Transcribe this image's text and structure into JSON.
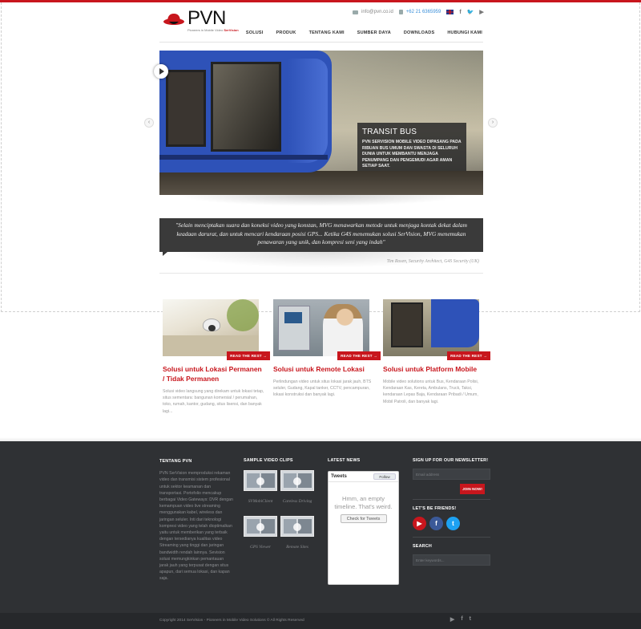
{
  "header": {
    "logo_text": "PVN",
    "logo_tagline": "Pioneers in Mobile Video",
    "logo_tagline_brand": "SerVision",
    "email": "info@pvn.co.id",
    "phone": "+62 21 6365959",
    "nav": [
      "SOLUSI",
      "PRODUK",
      "TENTANG KAMI",
      "SUMBER DAYA",
      "DOWNLOADS",
      "HUBUNGI KAMI"
    ]
  },
  "slider": {
    "title": "TRANSIT BUS",
    "description": "PVN SERVISION MOBILE VIDEO DIPASANG PADA RIBUAN BUS UMUM DAN SWASTA DI SELURUH DUNIA UNTUK MEMBANTU MENJAGA PENUMPANG DAN PENGEMUDI AGAR AMAN SETIAP SAAT.",
    "prev": "‹",
    "next": "›"
  },
  "testimonial": {
    "quote": "\"Selain menciptakan suara dan koneksi video yang konstan, MVG menawarkan metode untuk menjaga kontak dekat dalam keadaan darurat, dan untuk mencari kendaraan posisi GPS... Ketika G4S menemukan solusi SerVision, MVG menemukan penawaran yang unik, dan kompresi seni yang indah\"",
    "author": "Tim Rosen, Security Architect, G4S Security (UK)"
  },
  "solutions": [
    {
      "button": "READ THE REST →",
      "title": "Solusi untuk Lokasi Permanen / Tidak Permanen",
      "desc": "Solusi video langsung yang direkam untuk lokasi tetap, situs sementara: bangunan komersial / perumahan, toko, rumah, kantor, gudang, situs lisensi, dan banyak lagi..."
    },
    {
      "button": "READ THE REST →",
      "title": "Solusi untuk Remote Lokasi",
      "desc": "Perlindungan video untuk situs lokasi jarak jauh, BTS seluler, Gudang, Kapal tanker, CCTV, pencampuran, lokasi konstruksi dan banyak lagi."
    },
    {
      "button": "READ THE REST →",
      "title": "Solusi untuk Platform Mobile",
      "desc": "Mobile video solutions untuk Bus, Kendaraan Polisi, Kendaraan Kas, Kereta, Ambulans, Truck, Taksi, kendaraan Lepas Baja, Kendaraan Pribadi / Umum, Mobil Patroli, dan banyak lagi."
    }
  ],
  "footer": {
    "about_title": "TENTANG PVN",
    "about_text": "PVN SerVision memproduksi rekaman video dan transmisi sistem profesional untuk sektor keamanan dan transportasi. Portofolio mencakup berbagai Video Gateways: DVR dengan kemampuan video live streaming menggunakan kabel, wireless dan jaringan seluler. Inti dari teknologi kompresi video yang telah dioptimalkan yaitu untuk memberikan yang terbaik dengan tersedianya kualitas video Streaming yang tinggi dan jaringan bandwidth rendah lainnya. Sevision solusi memungkinkan pemantauan jarak jauh yang terpusat dengan situs apapun, dari semua lokasi, dan kapan saja.",
    "clips_title": "SAMPLE VIDEO CLIPS",
    "clips": [
      "SVMobiClient",
      "Careless Driving",
      "GPS Viewer",
      "Remote Sites"
    ],
    "news_title": "LATEST NEWS",
    "tweets_label": "Tweets",
    "follow_label": "Follow",
    "tweets_empty": "Hmm, an empty timeline. That's weird.",
    "check_tweets": "Check for Tweets",
    "signup_title": "SIGN UP FOR OUR NEWSLETTER!",
    "email_placeholder": "Email address",
    "join_label": "JOIN NOW!",
    "friends_title": "LET'S BE FRIENDS!",
    "search_title": "SEARCH",
    "search_placeholder": "Enter keywords...",
    "copyright": "Copyright 2014 SerVision - Pioneers in Mobile Video Solutions © All Rights Reserved"
  },
  "colors": {
    "accent": "#c8161d",
    "footer_bg": "#2f3134",
    "link_blue": "#3a8fd9"
  },
  "icons": [
    "mail-icon",
    "phone-icon",
    "uk-flag-icon",
    "facebook-icon",
    "twitter-icon",
    "youtube-icon"
  ]
}
